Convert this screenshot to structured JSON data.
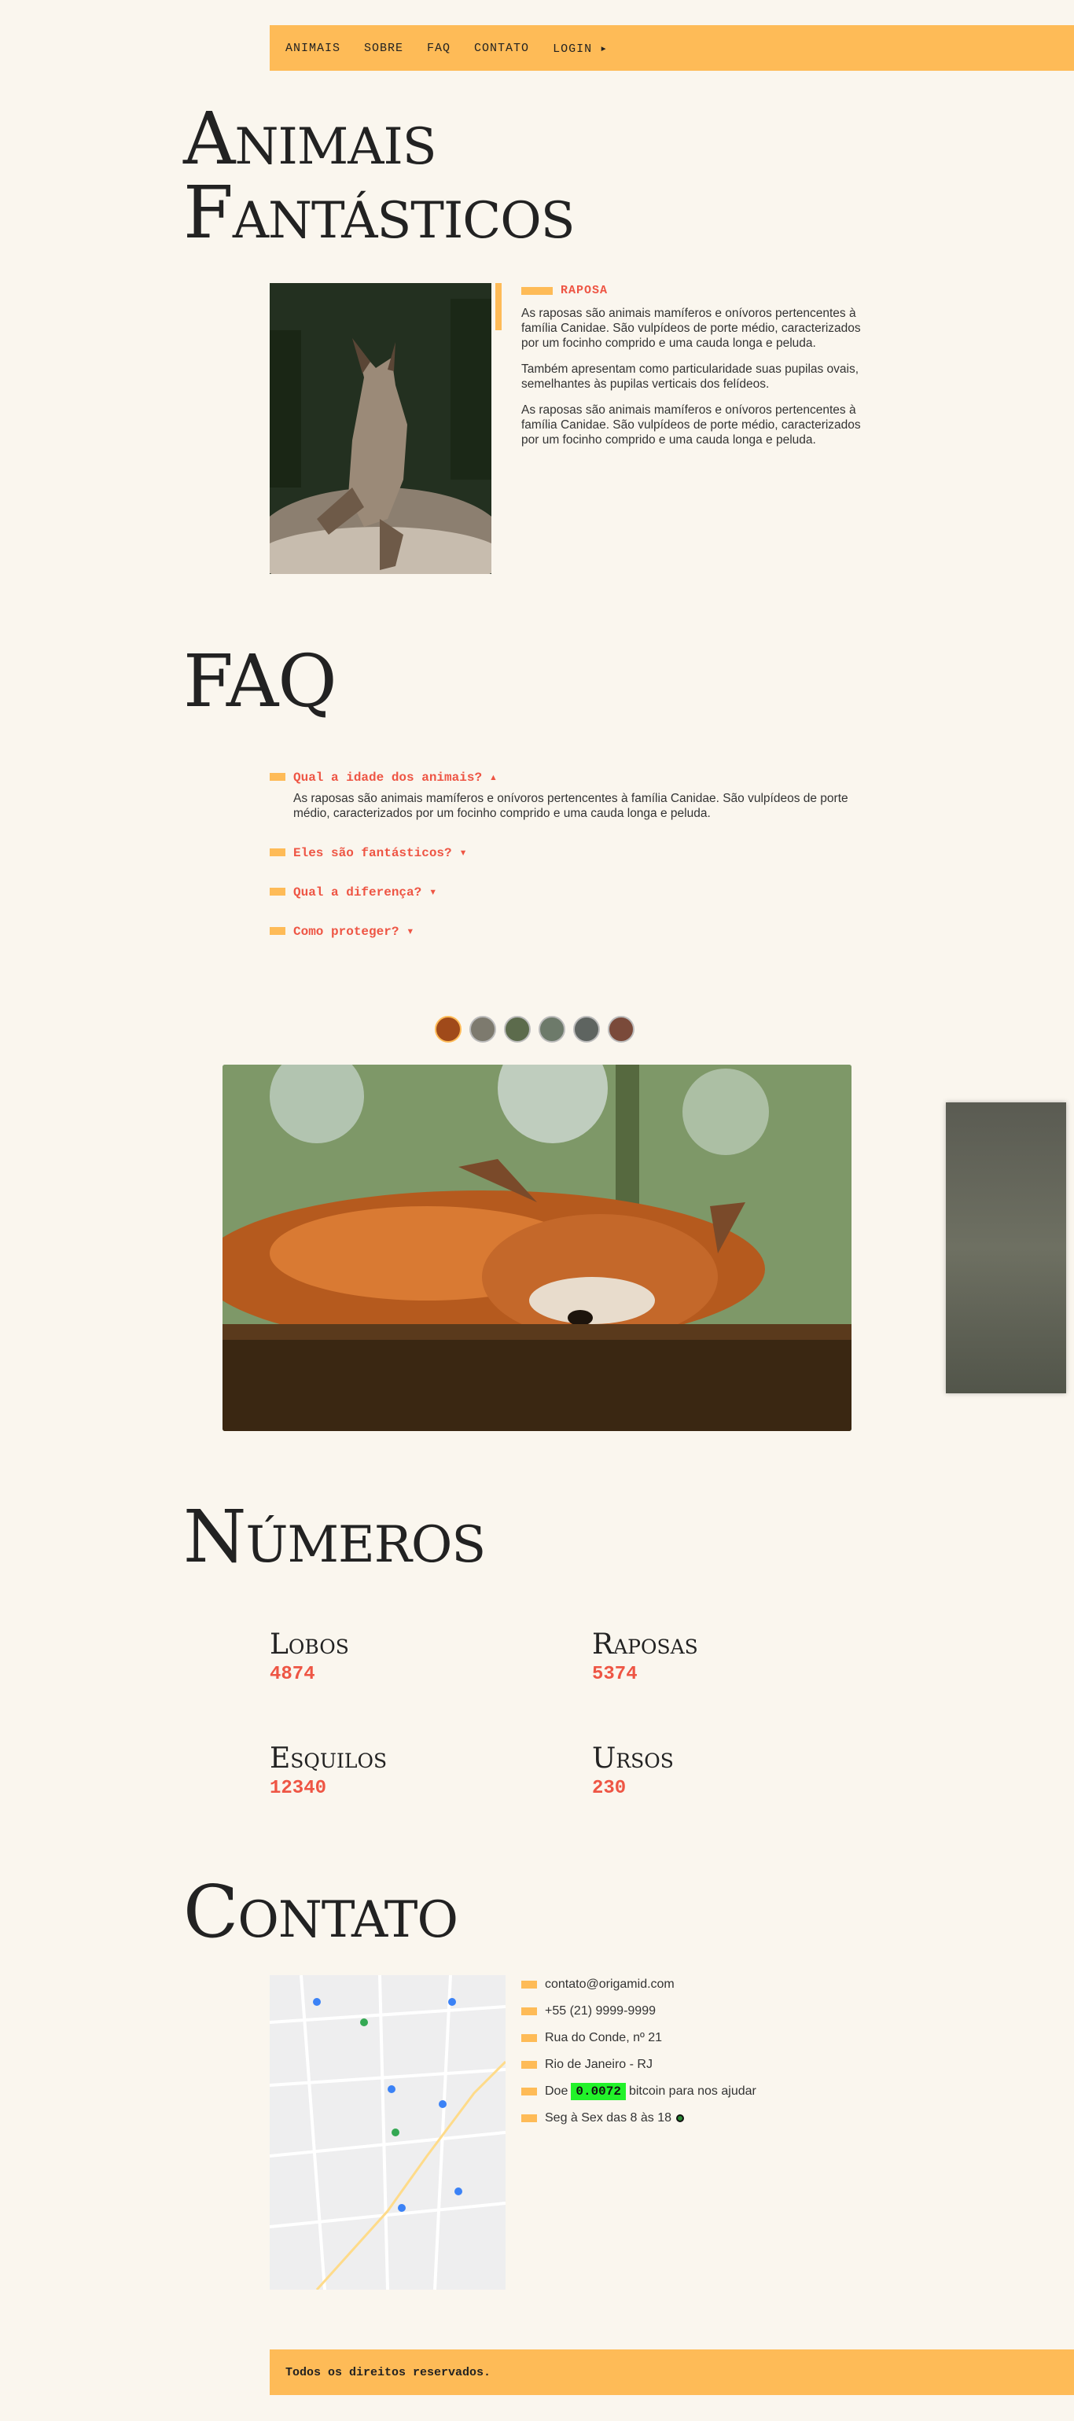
{
  "nav": {
    "items": [
      "ANIMAIS",
      "SOBRE",
      "FAQ",
      "CONTATO",
      "LOGIN ▸"
    ]
  },
  "animais": {
    "title_line1": "Animais",
    "title_line2": "Fantásticos",
    "label": "RAPOSA",
    "paragraphs": [
      "As raposas são animais mamíferos e onívoros pertencentes à família Canidae. São vulpídeos de porte médio, caracterizados por um focinho comprido e uma cauda longa e peluda.",
      "Também apresentam como particularidade suas pupilas ovais, semelhantes às pupilas verticais dos felídeos.",
      "As raposas são animais mamíferos e onívoros pertencentes à família Canidae. São vulpídeos de porte médio, caracterizados por um focinho comprido e uma cauda longa e peluda."
    ]
  },
  "faq": {
    "title": "FAQ",
    "items": [
      {
        "question": "Qual a idade dos animais? ▴",
        "answer": "As raposas são animais mamíferos e onívoros pertencentes à família Canidae. São vulpídeos de porte médio, caracterizados por um focinho comprido e uma cauda longa e peluda."
      },
      {
        "question": "Eles são fantásticos? ▾"
      },
      {
        "question": "Qual a diferença? ▾"
      },
      {
        "question": "Como proteger? ▾"
      }
    ]
  },
  "slider": {
    "thumb_colors": [
      "#a04a1a",
      "#7d7a6e",
      "#5c6b4c",
      "#6d7a6a",
      "#5e6460",
      "#7a4a3a"
    ]
  },
  "numeros": {
    "title": "Números",
    "items": [
      {
        "label": "Lobos",
        "value": "4874"
      },
      {
        "label": "Raposas",
        "value": "5374"
      },
      {
        "label": "Esquilos",
        "value": "12340"
      },
      {
        "label": "Ursos",
        "value": "230"
      }
    ]
  },
  "contato": {
    "title": "Contato",
    "email": "contato@origamid.com",
    "phone": "+55 (21) 9999-9999",
    "address": "Rua do Conde, nº 21",
    "city": "Rio de Janeiro - RJ",
    "donate_prefix": "Doe",
    "donate_amount": "0.0072",
    "donate_suffix": "bitcoin para nos ajudar",
    "hours": "Seg à Sex das 8 às 18"
  },
  "footer": {
    "text": "Todos os direitos reservados."
  },
  "colors": {
    "accent": "#FEBB57",
    "red": "#E54444",
    "background": "#FAF6EE",
    "bitcoin_highlight": "#22F22A"
  }
}
